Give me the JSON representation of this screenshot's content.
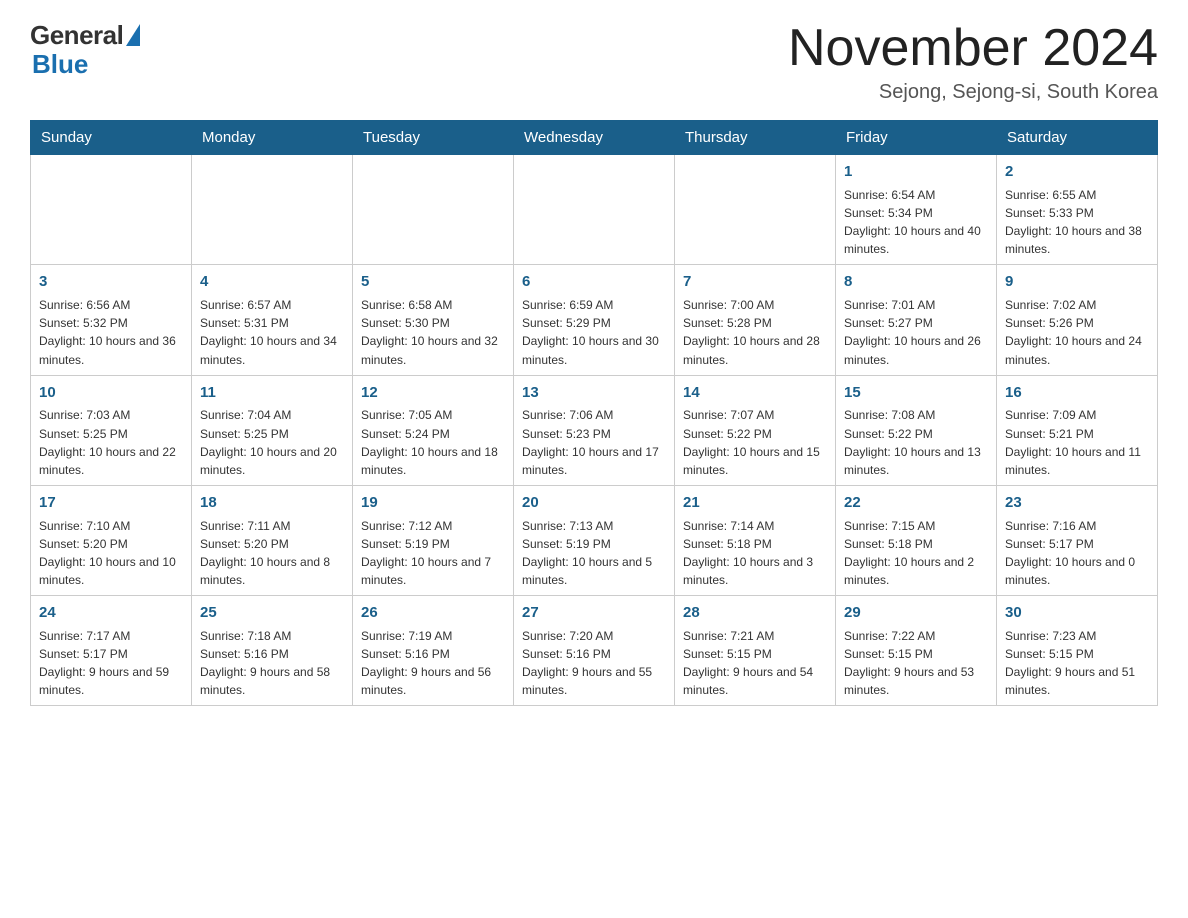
{
  "header": {
    "logo_general": "General",
    "logo_blue": "Blue",
    "month_title": "November 2024",
    "location": "Sejong, Sejong-si, South Korea"
  },
  "weekdays": [
    "Sunday",
    "Monday",
    "Tuesday",
    "Wednesday",
    "Thursday",
    "Friday",
    "Saturday"
  ],
  "weeks": [
    [
      {
        "day": "",
        "info": ""
      },
      {
        "day": "",
        "info": ""
      },
      {
        "day": "",
        "info": ""
      },
      {
        "day": "",
        "info": ""
      },
      {
        "day": "",
        "info": ""
      },
      {
        "day": "1",
        "info": "Sunrise: 6:54 AM\nSunset: 5:34 PM\nDaylight: 10 hours and 40 minutes."
      },
      {
        "day": "2",
        "info": "Sunrise: 6:55 AM\nSunset: 5:33 PM\nDaylight: 10 hours and 38 minutes."
      }
    ],
    [
      {
        "day": "3",
        "info": "Sunrise: 6:56 AM\nSunset: 5:32 PM\nDaylight: 10 hours and 36 minutes."
      },
      {
        "day": "4",
        "info": "Sunrise: 6:57 AM\nSunset: 5:31 PM\nDaylight: 10 hours and 34 minutes."
      },
      {
        "day": "5",
        "info": "Sunrise: 6:58 AM\nSunset: 5:30 PM\nDaylight: 10 hours and 32 minutes."
      },
      {
        "day": "6",
        "info": "Sunrise: 6:59 AM\nSunset: 5:29 PM\nDaylight: 10 hours and 30 minutes."
      },
      {
        "day": "7",
        "info": "Sunrise: 7:00 AM\nSunset: 5:28 PM\nDaylight: 10 hours and 28 minutes."
      },
      {
        "day": "8",
        "info": "Sunrise: 7:01 AM\nSunset: 5:27 PM\nDaylight: 10 hours and 26 minutes."
      },
      {
        "day": "9",
        "info": "Sunrise: 7:02 AM\nSunset: 5:26 PM\nDaylight: 10 hours and 24 minutes."
      }
    ],
    [
      {
        "day": "10",
        "info": "Sunrise: 7:03 AM\nSunset: 5:25 PM\nDaylight: 10 hours and 22 minutes."
      },
      {
        "day": "11",
        "info": "Sunrise: 7:04 AM\nSunset: 5:25 PM\nDaylight: 10 hours and 20 minutes."
      },
      {
        "day": "12",
        "info": "Sunrise: 7:05 AM\nSunset: 5:24 PM\nDaylight: 10 hours and 18 minutes."
      },
      {
        "day": "13",
        "info": "Sunrise: 7:06 AM\nSunset: 5:23 PM\nDaylight: 10 hours and 17 minutes."
      },
      {
        "day": "14",
        "info": "Sunrise: 7:07 AM\nSunset: 5:22 PM\nDaylight: 10 hours and 15 minutes."
      },
      {
        "day": "15",
        "info": "Sunrise: 7:08 AM\nSunset: 5:22 PM\nDaylight: 10 hours and 13 minutes."
      },
      {
        "day": "16",
        "info": "Sunrise: 7:09 AM\nSunset: 5:21 PM\nDaylight: 10 hours and 11 minutes."
      }
    ],
    [
      {
        "day": "17",
        "info": "Sunrise: 7:10 AM\nSunset: 5:20 PM\nDaylight: 10 hours and 10 minutes."
      },
      {
        "day": "18",
        "info": "Sunrise: 7:11 AM\nSunset: 5:20 PM\nDaylight: 10 hours and 8 minutes."
      },
      {
        "day": "19",
        "info": "Sunrise: 7:12 AM\nSunset: 5:19 PM\nDaylight: 10 hours and 7 minutes."
      },
      {
        "day": "20",
        "info": "Sunrise: 7:13 AM\nSunset: 5:19 PM\nDaylight: 10 hours and 5 minutes."
      },
      {
        "day": "21",
        "info": "Sunrise: 7:14 AM\nSunset: 5:18 PM\nDaylight: 10 hours and 3 minutes."
      },
      {
        "day": "22",
        "info": "Sunrise: 7:15 AM\nSunset: 5:18 PM\nDaylight: 10 hours and 2 minutes."
      },
      {
        "day": "23",
        "info": "Sunrise: 7:16 AM\nSunset: 5:17 PM\nDaylight: 10 hours and 0 minutes."
      }
    ],
    [
      {
        "day": "24",
        "info": "Sunrise: 7:17 AM\nSunset: 5:17 PM\nDaylight: 9 hours and 59 minutes."
      },
      {
        "day": "25",
        "info": "Sunrise: 7:18 AM\nSunset: 5:16 PM\nDaylight: 9 hours and 58 minutes."
      },
      {
        "day": "26",
        "info": "Sunrise: 7:19 AM\nSunset: 5:16 PM\nDaylight: 9 hours and 56 minutes."
      },
      {
        "day": "27",
        "info": "Sunrise: 7:20 AM\nSunset: 5:16 PM\nDaylight: 9 hours and 55 minutes."
      },
      {
        "day": "28",
        "info": "Sunrise: 7:21 AM\nSunset: 5:15 PM\nDaylight: 9 hours and 54 minutes."
      },
      {
        "day": "29",
        "info": "Sunrise: 7:22 AM\nSunset: 5:15 PM\nDaylight: 9 hours and 53 minutes."
      },
      {
        "day": "30",
        "info": "Sunrise: 7:23 AM\nSunset: 5:15 PM\nDaylight: 9 hours and 51 minutes."
      }
    ]
  ]
}
